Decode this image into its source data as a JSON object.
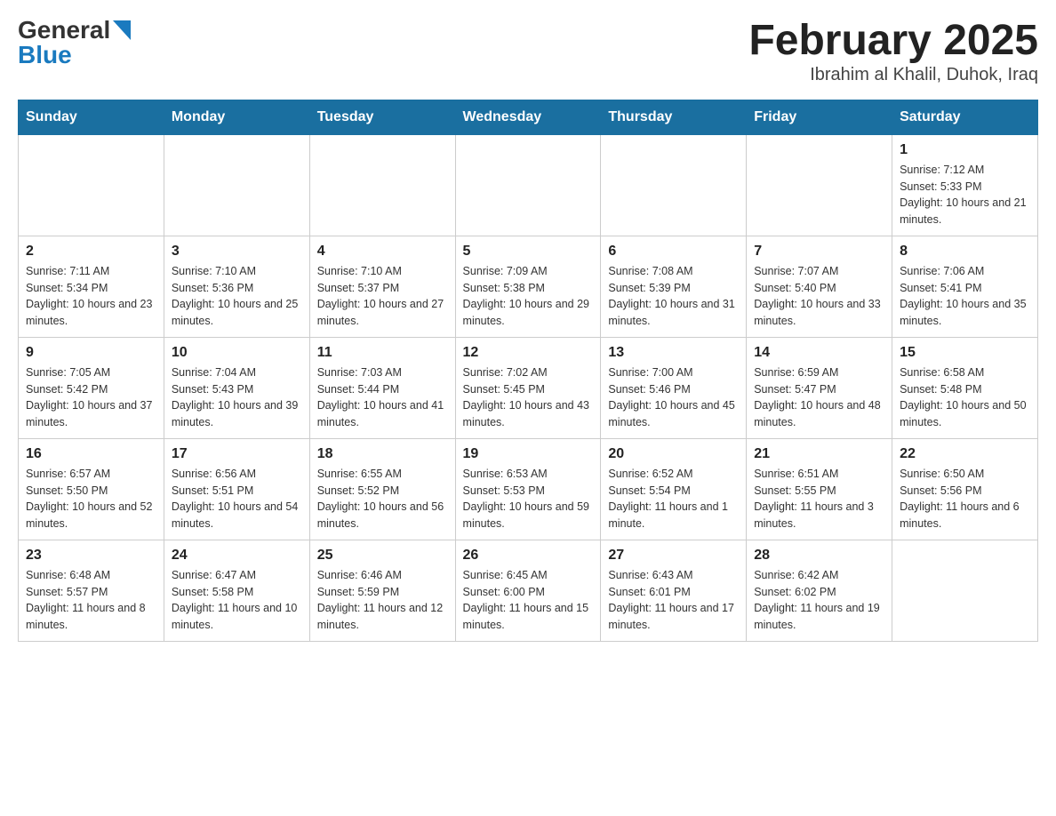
{
  "logo": {
    "general": "General",
    "blue": "Blue"
  },
  "title": "February 2025",
  "subtitle": "Ibrahim al Khalil, Duhok, Iraq",
  "weekdays": [
    "Sunday",
    "Monday",
    "Tuesday",
    "Wednesday",
    "Thursday",
    "Friday",
    "Saturday"
  ],
  "weeks": [
    [
      {
        "day": "",
        "info": ""
      },
      {
        "day": "",
        "info": ""
      },
      {
        "day": "",
        "info": ""
      },
      {
        "day": "",
        "info": ""
      },
      {
        "day": "",
        "info": ""
      },
      {
        "day": "",
        "info": ""
      },
      {
        "day": "1",
        "info": "Sunrise: 7:12 AM\nSunset: 5:33 PM\nDaylight: 10 hours and 21 minutes."
      }
    ],
    [
      {
        "day": "2",
        "info": "Sunrise: 7:11 AM\nSunset: 5:34 PM\nDaylight: 10 hours and 23 minutes."
      },
      {
        "day": "3",
        "info": "Sunrise: 7:10 AM\nSunset: 5:36 PM\nDaylight: 10 hours and 25 minutes."
      },
      {
        "day": "4",
        "info": "Sunrise: 7:10 AM\nSunset: 5:37 PM\nDaylight: 10 hours and 27 minutes."
      },
      {
        "day": "5",
        "info": "Sunrise: 7:09 AM\nSunset: 5:38 PM\nDaylight: 10 hours and 29 minutes."
      },
      {
        "day": "6",
        "info": "Sunrise: 7:08 AM\nSunset: 5:39 PM\nDaylight: 10 hours and 31 minutes."
      },
      {
        "day": "7",
        "info": "Sunrise: 7:07 AM\nSunset: 5:40 PM\nDaylight: 10 hours and 33 minutes."
      },
      {
        "day": "8",
        "info": "Sunrise: 7:06 AM\nSunset: 5:41 PM\nDaylight: 10 hours and 35 minutes."
      }
    ],
    [
      {
        "day": "9",
        "info": "Sunrise: 7:05 AM\nSunset: 5:42 PM\nDaylight: 10 hours and 37 minutes."
      },
      {
        "day": "10",
        "info": "Sunrise: 7:04 AM\nSunset: 5:43 PM\nDaylight: 10 hours and 39 minutes."
      },
      {
        "day": "11",
        "info": "Sunrise: 7:03 AM\nSunset: 5:44 PM\nDaylight: 10 hours and 41 minutes."
      },
      {
        "day": "12",
        "info": "Sunrise: 7:02 AM\nSunset: 5:45 PM\nDaylight: 10 hours and 43 minutes."
      },
      {
        "day": "13",
        "info": "Sunrise: 7:00 AM\nSunset: 5:46 PM\nDaylight: 10 hours and 45 minutes."
      },
      {
        "day": "14",
        "info": "Sunrise: 6:59 AM\nSunset: 5:47 PM\nDaylight: 10 hours and 48 minutes."
      },
      {
        "day": "15",
        "info": "Sunrise: 6:58 AM\nSunset: 5:48 PM\nDaylight: 10 hours and 50 minutes."
      }
    ],
    [
      {
        "day": "16",
        "info": "Sunrise: 6:57 AM\nSunset: 5:50 PM\nDaylight: 10 hours and 52 minutes."
      },
      {
        "day": "17",
        "info": "Sunrise: 6:56 AM\nSunset: 5:51 PM\nDaylight: 10 hours and 54 minutes."
      },
      {
        "day": "18",
        "info": "Sunrise: 6:55 AM\nSunset: 5:52 PM\nDaylight: 10 hours and 56 minutes."
      },
      {
        "day": "19",
        "info": "Sunrise: 6:53 AM\nSunset: 5:53 PM\nDaylight: 10 hours and 59 minutes."
      },
      {
        "day": "20",
        "info": "Sunrise: 6:52 AM\nSunset: 5:54 PM\nDaylight: 11 hours and 1 minute."
      },
      {
        "day": "21",
        "info": "Sunrise: 6:51 AM\nSunset: 5:55 PM\nDaylight: 11 hours and 3 minutes."
      },
      {
        "day": "22",
        "info": "Sunrise: 6:50 AM\nSunset: 5:56 PM\nDaylight: 11 hours and 6 minutes."
      }
    ],
    [
      {
        "day": "23",
        "info": "Sunrise: 6:48 AM\nSunset: 5:57 PM\nDaylight: 11 hours and 8 minutes."
      },
      {
        "day": "24",
        "info": "Sunrise: 6:47 AM\nSunset: 5:58 PM\nDaylight: 11 hours and 10 minutes."
      },
      {
        "day": "25",
        "info": "Sunrise: 6:46 AM\nSunset: 5:59 PM\nDaylight: 11 hours and 12 minutes."
      },
      {
        "day": "26",
        "info": "Sunrise: 6:45 AM\nSunset: 6:00 PM\nDaylight: 11 hours and 15 minutes."
      },
      {
        "day": "27",
        "info": "Sunrise: 6:43 AM\nSunset: 6:01 PM\nDaylight: 11 hours and 17 minutes."
      },
      {
        "day": "28",
        "info": "Sunrise: 6:42 AM\nSunset: 6:02 PM\nDaylight: 11 hours and 19 minutes."
      },
      {
        "day": "",
        "info": ""
      }
    ]
  ]
}
